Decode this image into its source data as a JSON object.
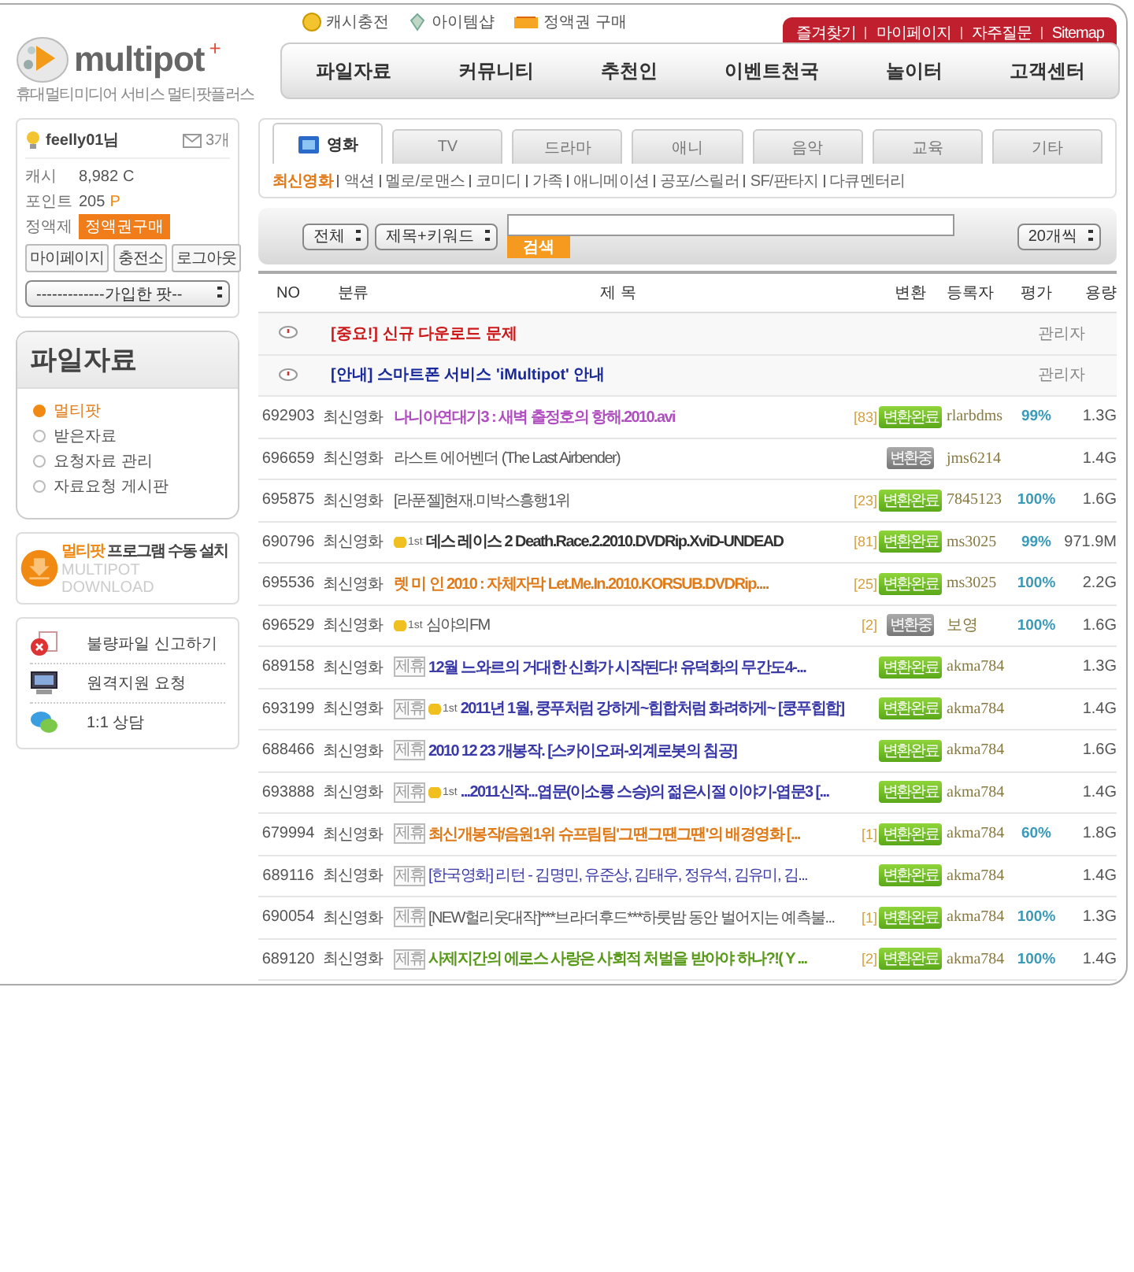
{
  "logo": {
    "name": "multipot",
    "plus": "+",
    "tagline": "휴대멀티미디어 서비스 멀티팟플러스"
  },
  "top_links": [
    {
      "kind": "coin",
      "label": "캐시충전"
    },
    {
      "kind": "shop",
      "label": "아이템샵"
    },
    {
      "kind": "ticket",
      "label": "정액권 구매"
    }
  ],
  "util_links": [
    "즐겨찾기",
    "마이페이지",
    "자주질문",
    "Sitemap"
  ],
  "nav": [
    "파일자료",
    "커뮤니티",
    "추천인",
    "이벤트천국",
    "놀이터",
    "고객센터"
  ],
  "user": {
    "name": "feelly01님",
    "mail_count": "3개",
    "stats": [
      {
        "label": "캐시",
        "value": "8,982",
        "unit": "C"
      },
      {
        "label": "포인트",
        "value": "205",
        "unit": "P"
      }
    ],
    "plan_label": "정액제",
    "plan_button": "정액권구매",
    "buttons": [
      "마이페이지",
      "충전소",
      "로그아웃"
    ],
    "pot_select": "-------------가입한 팟--"
  },
  "files_panel": {
    "title": "파일자료",
    "items": [
      {
        "label": "멀티팟",
        "selected": true
      },
      {
        "label": "받은자료",
        "selected": false
      },
      {
        "label": "요청자료 관리",
        "selected": false
      },
      {
        "label": "자료요청 게시판",
        "selected": false
      }
    ]
  },
  "download_banner": {
    "highlight": "멀티팟",
    "text": " 프로그램 수동 설치",
    "subtitle": "MULTIPOT DOWNLOAD"
  },
  "support": [
    {
      "kind": "report",
      "label": "불량파일 신고하기"
    },
    {
      "kind": "remote",
      "label": "원격지원 요청"
    },
    {
      "kind": "chat",
      "label": "1:1 상담"
    }
  ],
  "tabs": [
    {
      "label": "영화",
      "selected": true
    },
    {
      "label": "TV",
      "selected": false
    },
    {
      "label": "드라마",
      "selected": false
    },
    {
      "label": "애니",
      "selected": false
    },
    {
      "label": "음악",
      "selected": false
    },
    {
      "label": "교육",
      "selected": false
    },
    {
      "label": "기타",
      "selected": false
    }
  ],
  "subcategories": [
    {
      "label": "최신영화",
      "selected": true
    },
    {
      "label": "액션",
      "selected": false
    },
    {
      "label": "멜로/로맨스",
      "selected": false
    },
    {
      "label": "코미디",
      "selected": false
    },
    {
      "label": "가족",
      "selected": false
    },
    {
      "label": "애니메이션",
      "selected": false
    },
    {
      "label": "공포/스릴러",
      "selected": false
    },
    {
      "label": "SF/판타지",
      "selected": false
    },
    {
      "label": "다큐멘터리",
      "selected": false
    }
  ],
  "search": {
    "scope": "전체",
    "field": "제목+키워드",
    "button": "검색",
    "page_size": "20개씩"
  },
  "table": {
    "columns": [
      "NO",
      "분류",
      "제 목",
      "변환",
      "등록자",
      "평가",
      "용량"
    ],
    "notices": [
      {
        "title": "[중요!] 신규 다운로드 문제",
        "color": "#cc1a1a",
        "author": "관리자"
      },
      {
        "title": "[안내] 스마트폰 서비스 'iMultipot' 안내",
        "color": "#1a2a9a",
        "author": "관리자"
      }
    ],
    "rows": [
      {
        "no": "692903",
        "category": "최신영화",
        "title": "나니아연대기3 : 새벽 출정호의 항해.2010.avi",
        "color": "#b050c0",
        "bold": true,
        "comments": "[83]",
        "status": {
          "kind": "done",
          "label": "변환완료"
        },
        "uploader": "rlarbdms",
        "rating": "99%",
        "size": "1.3G"
      },
      {
        "no": "696659",
        "category": "최신영화",
        "title": "라스트 에어벤더 (The Last Airbender)",
        "color": "#555555",
        "bold": false,
        "status": {
          "kind": "progress",
          "label": "변환중"
        },
        "uploader": "jms6214",
        "size": "1.4G"
      },
      {
        "no": "695875",
        "category": "최신영화",
        "title": "[라푼젤]현재.미박스흥행1위",
        "color": "#555555",
        "bold": false,
        "comments": "[23]",
        "status": {
          "kind": "done",
          "label": "변환완료"
        },
        "uploader": "7845123",
        "rating": "100%",
        "size": "1.6G"
      },
      {
        "no": "690796",
        "category": "최신영화",
        "rank": "1st",
        "title": "데스 레이스 2 Death.Race.2.2010.DVDRip.XviD-UNDEAD",
        "color": "#333333",
        "bold": true,
        "comments": "[81]",
        "status": {
          "kind": "done",
          "label": "변환완료"
        },
        "uploader": "ms3025",
        "rating": "99%",
        "size": "971.9M"
      },
      {
        "no": "695536",
        "category": "최신영화",
        "title": "렛 미 인 2010 : 자체자막 Let.Me.In.2010.KORSUB.DVDRip....",
        "color": "#e07b1a",
        "bold": true,
        "comments": "[25]",
        "status": {
          "kind": "done",
          "label": "변환완료"
        },
        "uploader": "ms3025",
        "rating": "100%",
        "size": "2.2G"
      },
      {
        "no": "696529",
        "category": "최신영화",
        "rank": "1st",
        "title": "심야의FM",
        "color": "#555555",
        "bold": false,
        "comments": "[2]",
        "status": {
          "kind": "progress",
          "label": "변환중"
        },
        "uploader": "보영",
        "rating": "100%",
        "size": "1.6G"
      },
      {
        "no": "689158",
        "category": "최신영화",
        "partner": "제휴",
        "title": "12월 느와르의 거대한 신화가 시작된다! 유덕화의 무간도4-...",
        "color": "#3a3aa8",
        "bold": true,
        "status": {
          "kind": "done",
          "label": "변환완료"
        },
        "uploader": "akma784",
        "size": "1.3G"
      },
      {
        "no": "693199",
        "category": "최신영화",
        "partner": "제휴",
        "rank": "1st",
        "title": "2011년 1월, 쿵푸처럼 강하게~힙합처럼 화려하게~ [쿵푸힙합]",
        "color": "#3a3aa8",
        "bold": true,
        "status": {
          "kind": "done",
          "label": "변환완료"
        },
        "uploader": "akma784",
        "size": "1.4G"
      },
      {
        "no": "688466",
        "category": "최신영화",
        "partner": "제휴",
        "title": "2010 12 23 개봉작. [스카이오퍼-외계로봇의 침공]",
        "color": "#3a3aa8",
        "bold": true,
        "status": {
          "kind": "done",
          "label": "변환완료"
        },
        "uploader": "akma784",
        "size": "1.6G"
      },
      {
        "no": "693888",
        "category": "최신영화",
        "partner": "제휴",
        "rank": "1st",
        "title": "...2011신작...엽문(이소룡 스승)의 젊은시절 이야기-엽문3 [...",
        "color": "#3a3aa8",
        "bold": true,
        "status": {
          "kind": "done",
          "label": "변환완료"
        },
        "uploader": "akma784",
        "size": "1.4G"
      },
      {
        "no": "679994",
        "category": "최신영화",
        "partner": "제휴",
        "title": "최신개봉작/음원1위 슈프림팀'그땐그땐그땐'의 배경영화 [...",
        "color": "#e07b1a",
        "bold": true,
        "comments": "[1]",
        "status": {
          "kind": "done",
          "label": "변환완료"
        },
        "uploader": "akma784",
        "rating": "60%",
        "size": "1.8G"
      },
      {
        "no": "689116",
        "category": "최신영화",
        "partner": "제휴",
        "title": "[한국영화] 리턴 - 김명민, 유준상, 김태우, 정유석, 김유미, 김...",
        "color": "#3a3aa8",
        "bold": false,
        "status": {
          "kind": "done",
          "label": "변환완료"
        },
        "uploader": "akma784",
        "size": "1.4G"
      },
      {
        "no": "690054",
        "category": "최신영화",
        "partner": "제휴",
        "title": "[NEW헐리웃대작]***브라더후드***하룻밤 동안 벌어지는 예측불...",
        "color": "#555555",
        "bold": false,
        "comments": "[1]",
        "status": {
          "kind": "done",
          "label": "변환완료"
        },
        "uploader": "akma784",
        "rating": "100%",
        "size": "1.3G"
      },
      {
        "no": "689120",
        "category": "최신영화",
        "partner": "제휴",
        "title": "사제지간의 에로스 사랑은 사회적 처벌을 받아야 하나?!( Y ...",
        "color": "#5a9a1a",
        "bold": true,
        "comments": "[2]",
        "status": {
          "kind": "done",
          "label": "변환완료"
        },
        "uploader": "akma784",
        "rating": "100%",
        "size": "1.4G"
      }
    ]
  }
}
